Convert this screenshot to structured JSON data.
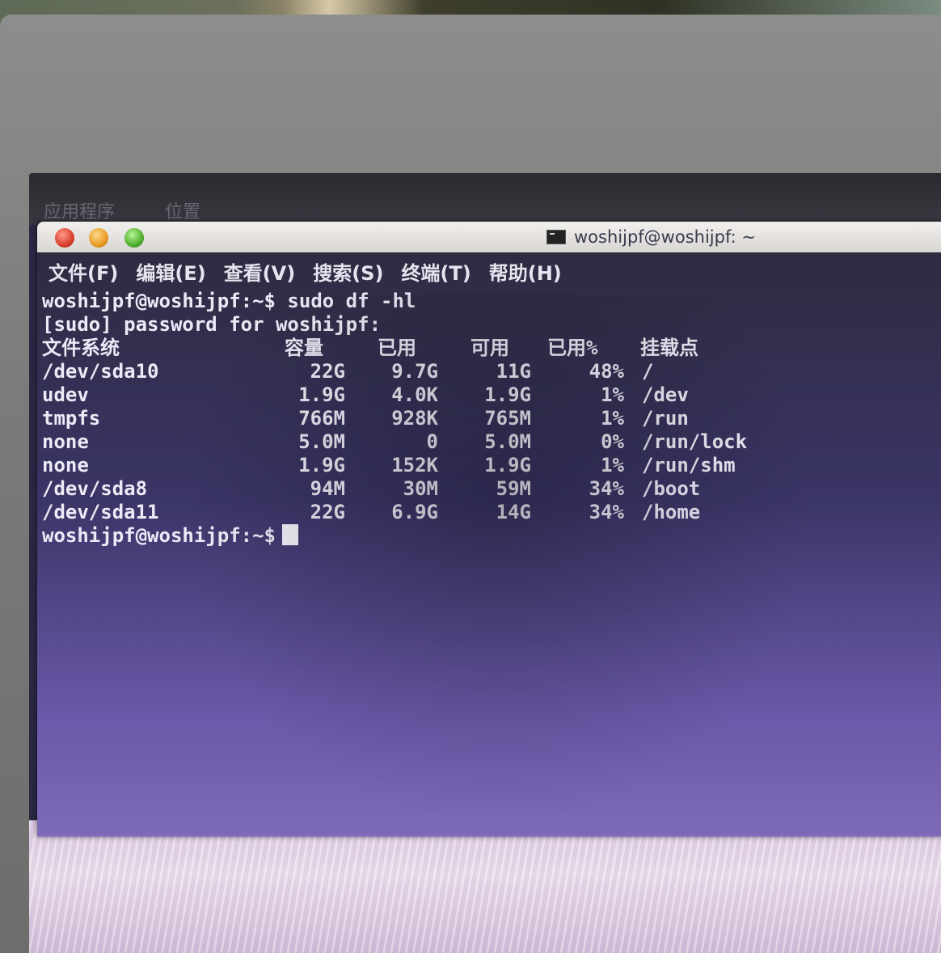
{
  "top_panel": {
    "menu_apps": "应用程序",
    "menu_places": "位置"
  },
  "window": {
    "title": "woshijpf@woshijpf: ~",
    "menu": [
      "文件(F)",
      "编辑(E)",
      "查看(V)",
      "搜索(S)",
      "终端(T)",
      "帮助(H)"
    ]
  },
  "terminal": {
    "command_line": "woshijpf@woshijpf:~$ sudo df -hl",
    "sudo_prompt": "[sudo] password for woshijpf:",
    "headers": {
      "filesystem": "文件系统",
      "size": "容量",
      "used": "已用",
      "avail": "可用",
      "use_pct": "已用%",
      "mount": "挂载点"
    },
    "rows": [
      {
        "fs": "/dev/sda10",
        "size": "22G",
        "used": "9.7G",
        "avail": "11G",
        "pct": "48%",
        "mount": "/"
      },
      {
        "fs": "udev",
        "size": "1.9G",
        "used": "4.0K",
        "avail": "1.9G",
        "pct": "1%",
        "mount": "/dev"
      },
      {
        "fs": "tmpfs",
        "size": "766M",
        "used": "928K",
        "avail": "765M",
        "pct": "1%",
        "mount": "/run"
      },
      {
        "fs": "none",
        "size": "5.0M",
        "used": "0",
        "avail": "5.0M",
        "pct": "0%",
        "mount": "/run/lock"
      },
      {
        "fs": "none",
        "size": "1.9G",
        "used": "152K",
        "avail": "1.9G",
        "pct": "1%",
        "mount": "/run/shm"
      },
      {
        "fs": "/dev/sda8",
        "size": "94M",
        "used": "30M",
        "avail": "59M",
        "pct": "34%",
        "mount": "/boot"
      },
      {
        "fs": "/dev/sda11",
        "size": "22G",
        "used": "6.9G",
        "avail": "14G",
        "pct": "34%",
        "mount": "/home"
      }
    ],
    "final_prompt": "woshijpf@woshijpf:~$"
  }
}
